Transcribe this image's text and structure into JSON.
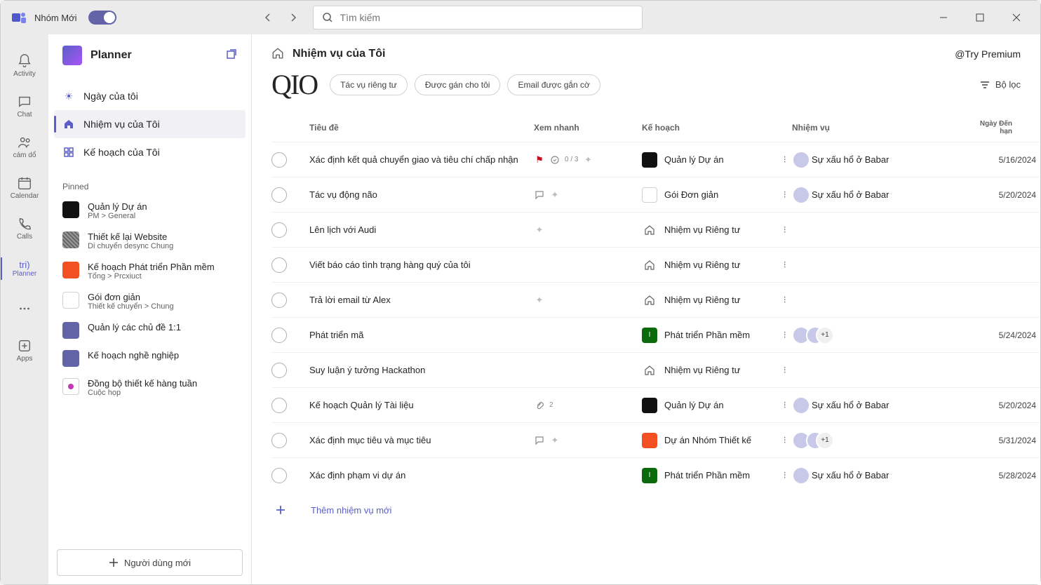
{
  "titlebar": {
    "app_name": "Nhóm Mới",
    "search_placeholder": "Tìm kiếm"
  },
  "rail": {
    "activity": "Activity",
    "chat": "Chat",
    "camdo": "cám dổ",
    "calendar": "Calendar",
    "calls": "Calls",
    "planner_short": "tri)",
    "planner": "Planner",
    "apps": "Apps"
  },
  "sidebar": {
    "title": "Planner",
    "nav": {
      "myday": "Ngày của tôi",
      "mytasks": "Nhiệm vụ của Tôi",
      "myplans": "Kế hoạch của Tôi"
    },
    "pinned_label": "Pinned",
    "pinned": [
      {
        "title": "Quản lý Dự án",
        "sub": "PM &gt; General",
        "color": "#111"
      },
      {
        "title": "Thiết kế lại Website",
        "sub": "Di chuyển desync Chung",
        "color": "#555",
        "stripes": true
      },
      {
        "title": "Kế hoạch Phát triển Phần mềm",
        "sub": "Tổng &gt; Prcxiuct",
        "color": "#f25022"
      },
      {
        "title": "Gói đơn giản",
        "sub": "Thiết kế chuyển &gt; Chung",
        "color": "#fff",
        "ring": true
      },
      {
        "title": "Quản lý các chủ đề 1:1",
        "sub": "",
        "color": "#6264a7"
      },
      {
        "title": "Kế hoạch nghề nghiệp",
        "sub": "",
        "color": "#6264a7"
      },
      {
        "title": "Đồng bộ thiết kế hàng tuần",
        "sub": "Cuộc họp",
        "color": "#fff",
        "ring": true,
        "dot": "#c239b3"
      }
    ],
    "footer_button": "Người dùng mới"
  },
  "main": {
    "title": "Nhiệm vụ của Tôi",
    "premium": "@Try Premium",
    "big": "QIO",
    "pills": [
      "Tác vụ riêng tư",
      "Được gán cho tôi",
      "Email được gắn cờ"
    ],
    "filter_label": "Bộ lọc",
    "columns": {
      "title": "Tiêu đề",
      "quick": "Xem nhanh",
      "plan": "Kế hoạch",
      "assign": "Nhiệm vụ",
      "due": "Ngày Đến hạn"
    },
    "tasks": [
      {
        "title": "Xác định kết quả chuyển giao và tiêu chí chấp nhận",
        "quick": {
          "flag": true,
          "progress": "0 / 3",
          "spark": true
        },
        "plan": {
          "icon": "#111",
          "name": "Quản lý Dự án"
        },
        "assign": {
          "avatars": 1,
          "text": "Sự xấu hổ ở Babar"
        },
        "due": "5/16/2024"
      },
      {
        "title": "Tác vụ động não",
        "quick": {
          "chat": true,
          "spark": true
        },
        "plan": {
          "icon": "#fff",
          "ring": true,
          "name": "Gói Đơn giản"
        },
        "assign": {
          "avatars": 1,
          "text": "Sự xấu hổ ở Babar"
        },
        "due": "5/20/2024"
      },
      {
        "title": "Lên lịch với Audi",
        "quick": {
          "spark": true
        },
        "plan": {
          "home": true,
          "name": "Nhiệm vụ Riêng tư"
        },
        "assign": {},
        "due": ""
      },
      {
        "title": "Viết báo cáo tình trạng hàng quý của tôi",
        "quick": {},
        "plan": {
          "home": true,
          "name": "Nhiệm vụ Riêng tư"
        },
        "assign": {},
        "due": ""
      },
      {
        "title": "Trả lời email từ Alex",
        "quick": {
          "spark": true
        },
        "plan": {
          "home": true,
          "name": "Nhiệm vụ Riêng tư"
        },
        "assign": {},
        "due": ""
      },
      {
        "title": "Phát triển mã",
        "quick": {},
        "plan": {
          "icon": "#0b6a0b",
          "lbl": "I",
          "name": "Phát triển Phần mềm"
        },
        "assign": {
          "avatars": 2,
          "plus": "+1"
        },
        "due": "5/24/2024"
      },
      {
        "title": "Suy luận ý tưởng Hackathon",
        "quick": {},
        "plan": {
          "home": true,
          "name": "Nhiệm vụ Riêng tư"
        },
        "assign": {},
        "due": ""
      },
      {
        "title": "Kế hoạch Quản lý Tài liệu",
        "quick": {
          "attach": "2"
        },
        "plan": {
          "icon": "#111",
          "name": "Quản lý Dự án"
        },
        "assign": {
          "avatars": 1,
          "text": "Sự xấu hổ ở Babar"
        },
        "due": "5/20/2024"
      },
      {
        "title": "Xác định mục tiêu và mục tiêu",
        "quick": {
          "chat": true,
          "spark": true
        },
        "plan": {
          "icon": "#f25022",
          "name": "Dự án Nhóm Thiết kế"
        },
        "assign": {
          "avatars": 2,
          "plus": "+1"
        },
        "due": "5/31/2024"
      },
      {
        "title": "Xác định phạm vi dự án",
        "quick": {},
        "plan": {
          "icon": "#0b6a0b",
          "lbl": "I",
          "name": "Phát triển Phần mềm"
        },
        "assign": {
          "avatars": 1,
          "text": "Sự xấu hổ ở Babar"
        },
        "due": "5/28/2024"
      }
    ],
    "add_task": "Thêm nhiệm vụ mới"
  }
}
